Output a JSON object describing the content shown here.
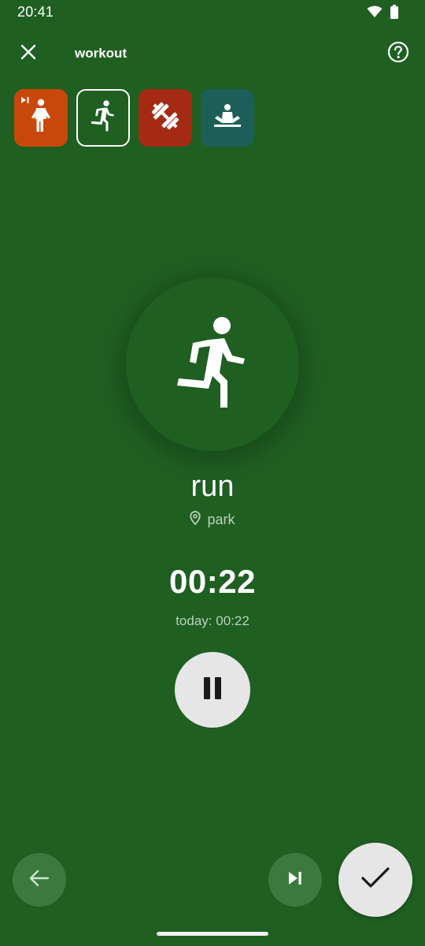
{
  "status_bar": {
    "time": "20:41",
    "icons": [
      "wifi-icon",
      "battery-icon"
    ]
  },
  "app_bar": {
    "title": "workout",
    "close_icon": "close-icon",
    "help_icon": "help-circle-icon"
  },
  "activities": [
    {
      "icon": "walk-icon",
      "color": "#c9470a",
      "selected": false,
      "badge": "skip-next-icon"
    },
    {
      "icon": "run-icon",
      "color": "#1f5f22",
      "selected": true
    },
    {
      "icon": "weights-icon",
      "color": "#a52a14",
      "selected": false
    },
    {
      "icon": "meditation-icon",
      "color": "#1d5f58",
      "selected": false
    }
  ],
  "current": {
    "icon": "run-icon",
    "name": "run",
    "location": "park",
    "timer": "00:22",
    "today": "today: 00:22"
  },
  "controls": {
    "pause_icon": "pause-icon",
    "back_icon": "arrow-left-icon",
    "skip_icon": "skip-next-icon",
    "done_icon": "check-icon"
  },
  "colors": {
    "background": "#1f5f22",
    "button_light": "#e6e6e6",
    "button_dark": "#3a7a3e",
    "muted_text": "#b9d3b9"
  }
}
